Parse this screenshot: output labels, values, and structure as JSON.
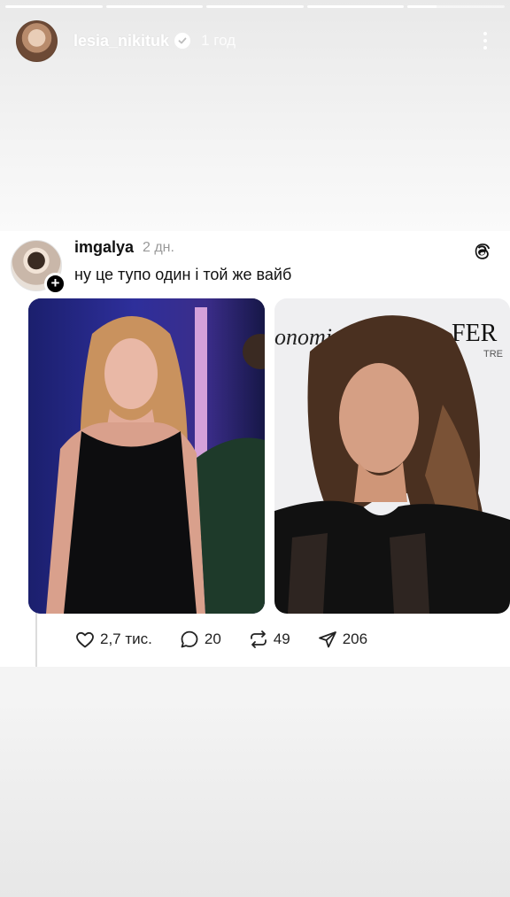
{
  "story": {
    "username": "lesia_nikituk",
    "time": "1 год",
    "segments": [
      1,
      1,
      1,
      1,
      0.3
    ]
  },
  "post": {
    "username": "imgalya",
    "time": "2 дн.",
    "text": "ну це тупо один і той же вайб",
    "photos": [
      "left-photo",
      "right-photo"
    ],
    "stats": {
      "likes": "2,7 тис.",
      "replies": "20",
      "reposts": "49",
      "shares": "206"
    }
  },
  "photo_right": {
    "backdrop_text_1": "onomics",
    "backdrop_text_2": "FER",
    "backdrop_text_3": "TRE"
  },
  "icons": [
    "verified-icon",
    "more-icon",
    "threads-logo-icon",
    "follow-plus-icon",
    "heart-icon",
    "reply-icon",
    "repost-icon",
    "share-icon"
  ]
}
